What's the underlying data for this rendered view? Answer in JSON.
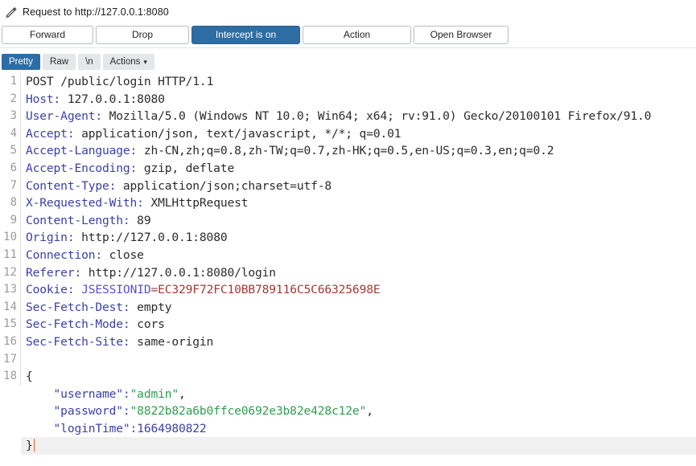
{
  "titlebar": {
    "icon": "pencil-icon",
    "title": "Request to http://127.0.0.1:8080"
  },
  "action_buttons": [
    {
      "label": "Forward",
      "primary": false
    },
    {
      "label": "Drop",
      "primary": false
    },
    {
      "label": "Intercept is on",
      "primary": true
    },
    {
      "label": "Action",
      "primary": false
    },
    {
      "label": "Open Browser",
      "primary": false
    }
  ],
  "view_tabs": [
    {
      "label": "Pretty",
      "active": true,
      "caret": false
    },
    {
      "label": "Raw",
      "active": false,
      "caret": false
    },
    {
      "label": "\\n",
      "active": false,
      "caret": false
    },
    {
      "label": "Actions",
      "active": false,
      "caret": true
    }
  ],
  "colors": {
    "accent_blue": "#2e6da4",
    "header_name": "#3b3fa6",
    "cookie_name": "#5b4fd0",
    "cookie_value": "#a33a34",
    "json_string": "#2e9e4f",
    "json_number": "#3b3fa6",
    "caret": "#e8611a",
    "gutter_text": "#9a9a9a",
    "current_line_bg": "#f0f0f0"
  },
  "request": {
    "method": "POST",
    "path": "/public/login",
    "version": "HTTP/1.1",
    "headers": [
      {
        "name": "Host",
        "value": "127.0.0.1:8080"
      },
      {
        "name": "User-Agent",
        "value": "Mozilla/5.0 (Windows NT 10.0; Win64; x64; rv:91.0) Gecko/20100101 Firefox/91.0"
      },
      {
        "name": "Accept",
        "value": "application/json, text/javascript, */*; q=0.01"
      },
      {
        "name": "Accept-Language",
        "value": "zh-CN,zh;q=0.8,zh-TW;q=0.7,zh-HK;q=0.5,en-US;q=0.3,en;q=0.2"
      },
      {
        "name": "Accept-Encoding",
        "value": "gzip, deflate"
      },
      {
        "name": "Content-Type",
        "value": "application/json;charset=utf-8"
      },
      {
        "name": "X-Requested-With",
        "value": "XMLHttpRequest"
      },
      {
        "name": "Content-Length",
        "value": "89"
      },
      {
        "name": "Origin",
        "value": "http://127.0.0.1:8080"
      },
      {
        "name": "Connection",
        "value": "close"
      },
      {
        "name": "Referer",
        "value": "http://127.0.0.1:8080/login"
      },
      {
        "name": "Cookie",
        "value": "JSESSIONID=EC329F72FC10BB789116C5C66325698E",
        "cookie_name": "JSESSIONID",
        "cookie_value": "EC329F72FC10BB789116C5C66325698E"
      },
      {
        "name": "Sec-Fetch-Dest",
        "value": "empty"
      },
      {
        "name": "Sec-Fetch-Mode",
        "value": "cors"
      },
      {
        "name": "Sec-Fetch-Site",
        "value": "same-origin"
      }
    ],
    "body": {
      "username": "admin",
      "password": "8822b82a6b0ffce0692e3b82e428c12e",
      "loginTime": "1664980822"
    }
  },
  "line_numbers": {
    "request_line": "1",
    "blank_line": "17",
    "body_start": "18"
  }
}
